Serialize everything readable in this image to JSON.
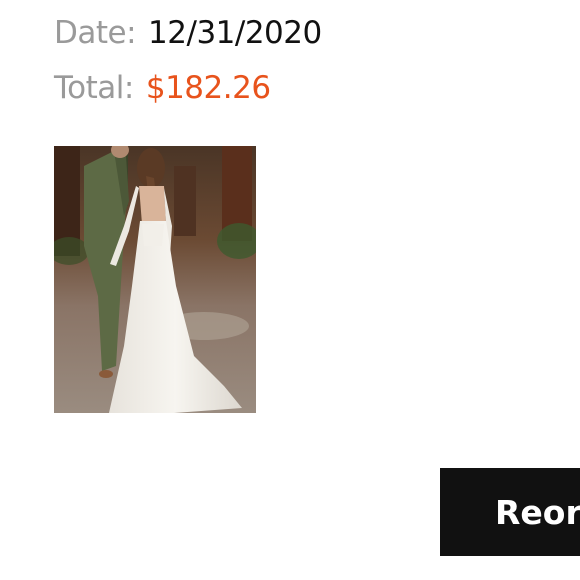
{
  "order": {
    "date_label": "Date:",
    "date_value": "12/31/2020",
    "total_label": "Total:",
    "total_value": "$182.26"
  },
  "product_image": {
    "subject": "wedding-dress-photo"
  },
  "actions": {
    "reorder_label": "Reorder"
  },
  "colors": {
    "label": "#9a9a9a",
    "date_value": "#111111",
    "total_value": "#e8531c",
    "button_bg": "#111111",
    "button_text": "#ffffff"
  }
}
